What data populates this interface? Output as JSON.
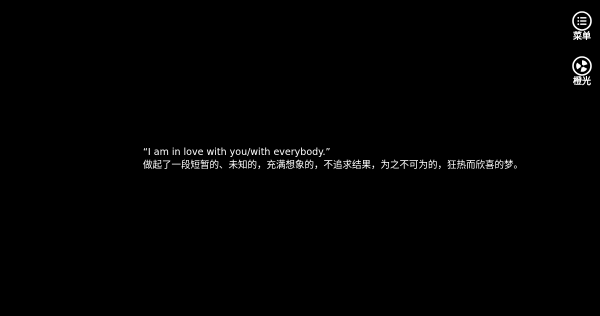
{
  "side_menu": {
    "menu_label": "菜单",
    "menu_icon": "menu-list-icon",
    "orange_label": "橙光",
    "orange_icon": "orange-light-logo-icon"
  },
  "content": {
    "line1": "“I am in love with you/with everybody.”",
    "line2": "做起了一段短暂的、未知的，充满想象的，不追求结果，为之不可为的，狂热而欣喜的梦。"
  },
  "colors": {
    "background": "#000000",
    "text": "#ffffff"
  }
}
